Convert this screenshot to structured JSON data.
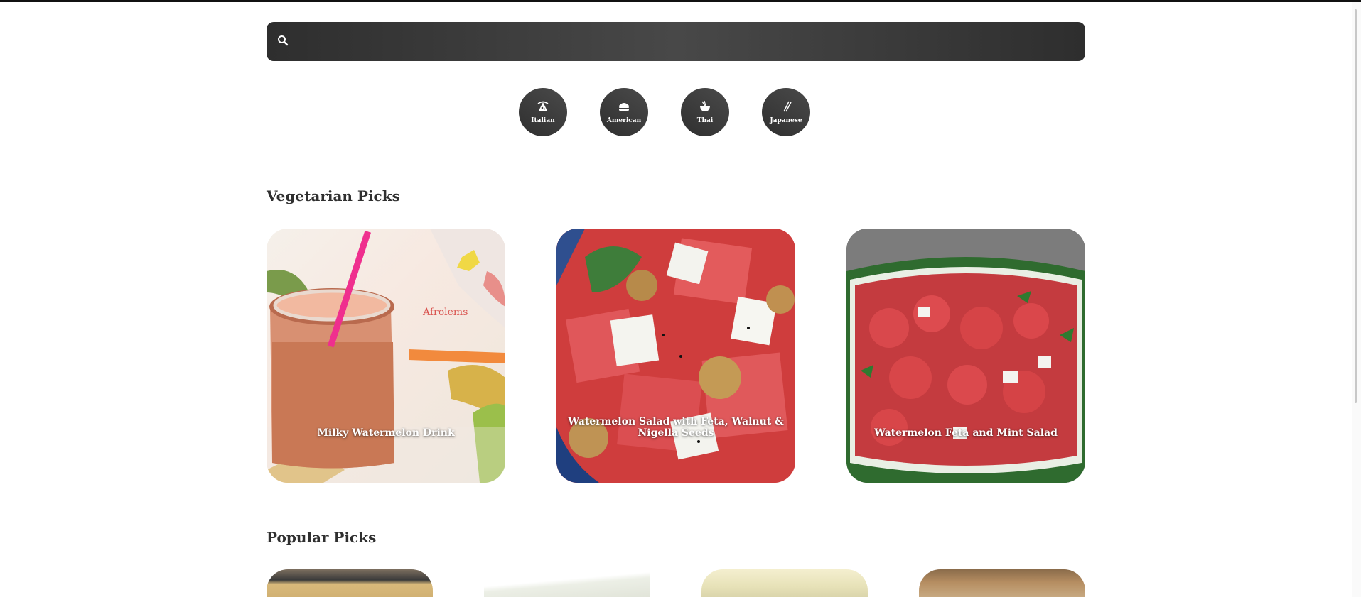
{
  "search": {
    "placeholder": "",
    "value": ""
  },
  "cuisines": [
    {
      "label": "Italian",
      "icon": "pizza-icon"
    },
    {
      "label": "American",
      "icon": "burger-icon"
    },
    {
      "label": "Thai",
      "icon": "noodle-bowl-icon"
    },
    {
      "label": "Japanese",
      "icon": "chopsticks-icon"
    }
  ],
  "sections": {
    "vegetarian": {
      "title": "Vegetarian Picks",
      "items": [
        {
          "title": "Milky Watermelon Drink",
          "watermark": "Afrolems"
        },
        {
          "title": "Watermelon Salad with Feta, Walnut & Nigella Seeds"
        },
        {
          "title": "Watermelon Feta and Mint Salad"
        }
      ]
    },
    "popular": {
      "title": "Popular Picks"
    }
  },
  "colors": {
    "search_bar": "#3a3a3a",
    "cuisine_button": "#3c3c3c",
    "heading": "#2f2f2f",
    "caption": "#ffffff"
  }
}
